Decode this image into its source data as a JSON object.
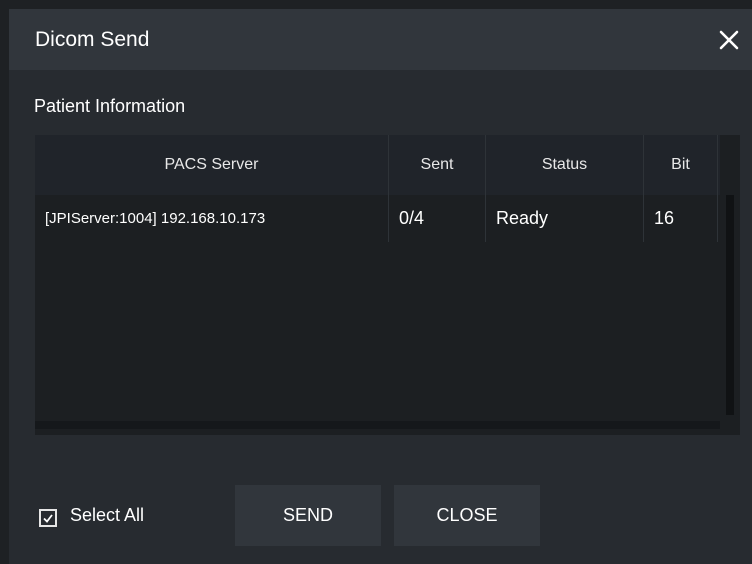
{
  "window": {
    "title": "Dicom Send"
  },
  "section": {
    "label": "Patient Information"
  },
  "table": {
    "headers": {
      "server": "PACS Server",
      "sent": "Sent",
      "status": "Status",
      "bit": "Bit"
    },
    "rows": [
      {
        "server": "[JPIServer:1004] 192.168.10.173",
        "sent": "0/4",
        "status": "Ready",
        "bit": "16"
      }
    ]
  },
  "footer": {
    "select_all_label": "Select All",
    "select_all_checked": true,
    "send_label": "SEND",
    "close_label": "CLOSE"
  },
  "icons": {
    "close": "close-icon",
    "checkbox": "checkmark-icon"
  }
}
